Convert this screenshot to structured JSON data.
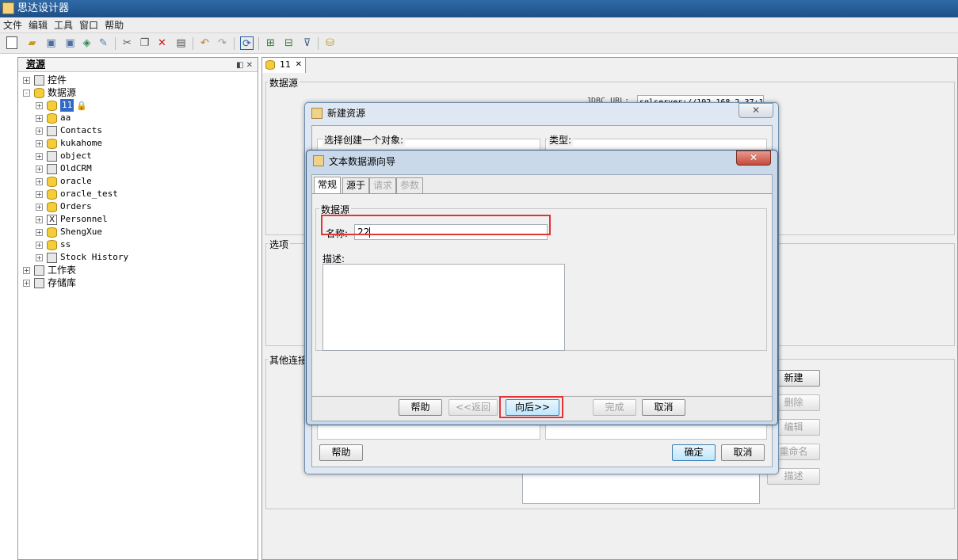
{
  "window": {
    "title": "思达设计器"
  },
  "menu": [
    "文件",
    "编辑",
    "工具",
    "窗口",
    "帮助"
  ],
  "toolbar_icons": [
    "new-icon",
    "open-icon",
    "save-icon",
    "save-all-icon",
    "publish-icon",
    "edit-icon",
    "cut-icon",
    "copy-icon",
    "delete-icon",
    "paste-icon",
    "undo-icon",
    "redo-icon",
    "refresh-icon",
    "add-child-icon",
    "move-icon",
    "filter-icon",
    "datasource-icon"
  ],
  "left_panel": {
    "title": "资源",
    "tree": [
      {
        "label": "控件",
        "level": 0,
        "expand": "+",
        "icon": "controls-icon"
      },
      {
        "label": "数据源",
        "level": 0,
        "expand": "-",
        "icon": "database-icon"
      },
      {
        "label": "11",
        "level": 1,
        "expand": "+",
        "icon": "database-icon",
        "selected": true,
        "locked": true
      },
      {
        "label": "aa",
        "level": 1,
        "expand": "+",
        "icon": "database-icon"
      },
      {
        "label": "Contacts",
        "level": 1,
        "expand": "+",
        "icon": "contacts-db-icon"
      },
      {
        "label": "kukahome",
        "level": 1,
        "expand": "+",
        "icon": "database-icon"
      },
      {
        "label": "object",
        "level": 1,
        "expand": "+",
        "icon": "object-icon"
      },
      {
        "label": "OldCRM",
        "level": 1,
        "expand": "+",
        "icon": "file-icon"
      },
      {
        "label": "oracle",
        "level": 1,
        "expand": "+",
        "icon": "database-icon"
      },
      {
        "label": "oracle_test",
        "level": 1,
        "expand": "+",
        "icon": "database-icon"
      },
      {
        "label": "Orders",
        "level": 1,
        "expand": "+",
        "icon": "database-icon"
      },
      {
        "label": "Personnel",
        "level": 1,
        "expand": "+",
        "icon": "excel-icon"
      },
      {
        "label": "ShengXue",
        "level": 1,
        "expand": "+",
        "icon": "database-icon"
      },
      {
        "label": "ss",
        "level": 1,
        "expand": "+",
        "icon": "database-icon"
      },
      {
        "label": "Stock History",
        "level": 1,
        "expand": "+",
        "icon": "file-icon"
      },
      {
        "label": "工作表",
        "level": 0,
        "expand": "+",
        "icon": "worksheet-icon"
      },
      {
        "label": "存储库",
        "level": 0,
        "expand": "+",
        "icon": "repository-icon"
      }
    ]
  },
  "editor": {
    "tab_label": "11",
    "datasource_group": "数据源",
    "jdbc_label": "JDBC URL:",
    "jdbc_value": "sqlserver://192.168.2.37:1433",
    "options_group": "选项",
    "other_group": "其他连接",
    "side_buttons": [
      "新建",
      "删除",
      "编辑",
      "重命名",
      "描述"
    ]
  },
  "new_resource_dialog": {
    "title": "新建资源",
    "select_label": "选择创建一个对象:",
    "type_label": "类型:",
    "help": "帮助",
    "ok": "确定",
    "cancel": "取消"
  },
  "wizard_dialog": {
    "title": "文本数据源向导",
    "tabs": [
      "常规",
      "源于",
      "请求",
      "参数"
    ],
    "group_title": "数据源",
    "name_label": "名称:",
    "name_value": "22",
    "desc_label": "描述:",
    "desc_value": "",
    "buttons": {
      "help": "帮助",
      "back": "<<返回",
      "next": "向后>>",
      "finish": "完成",
      "cancel": "取消"
    }
  },
  "colors": {
    "highlight_red": "#e0363a",
    "selection_blue": "#316ac5",
    "titlebar": "#2f6aa8"
  }
}
